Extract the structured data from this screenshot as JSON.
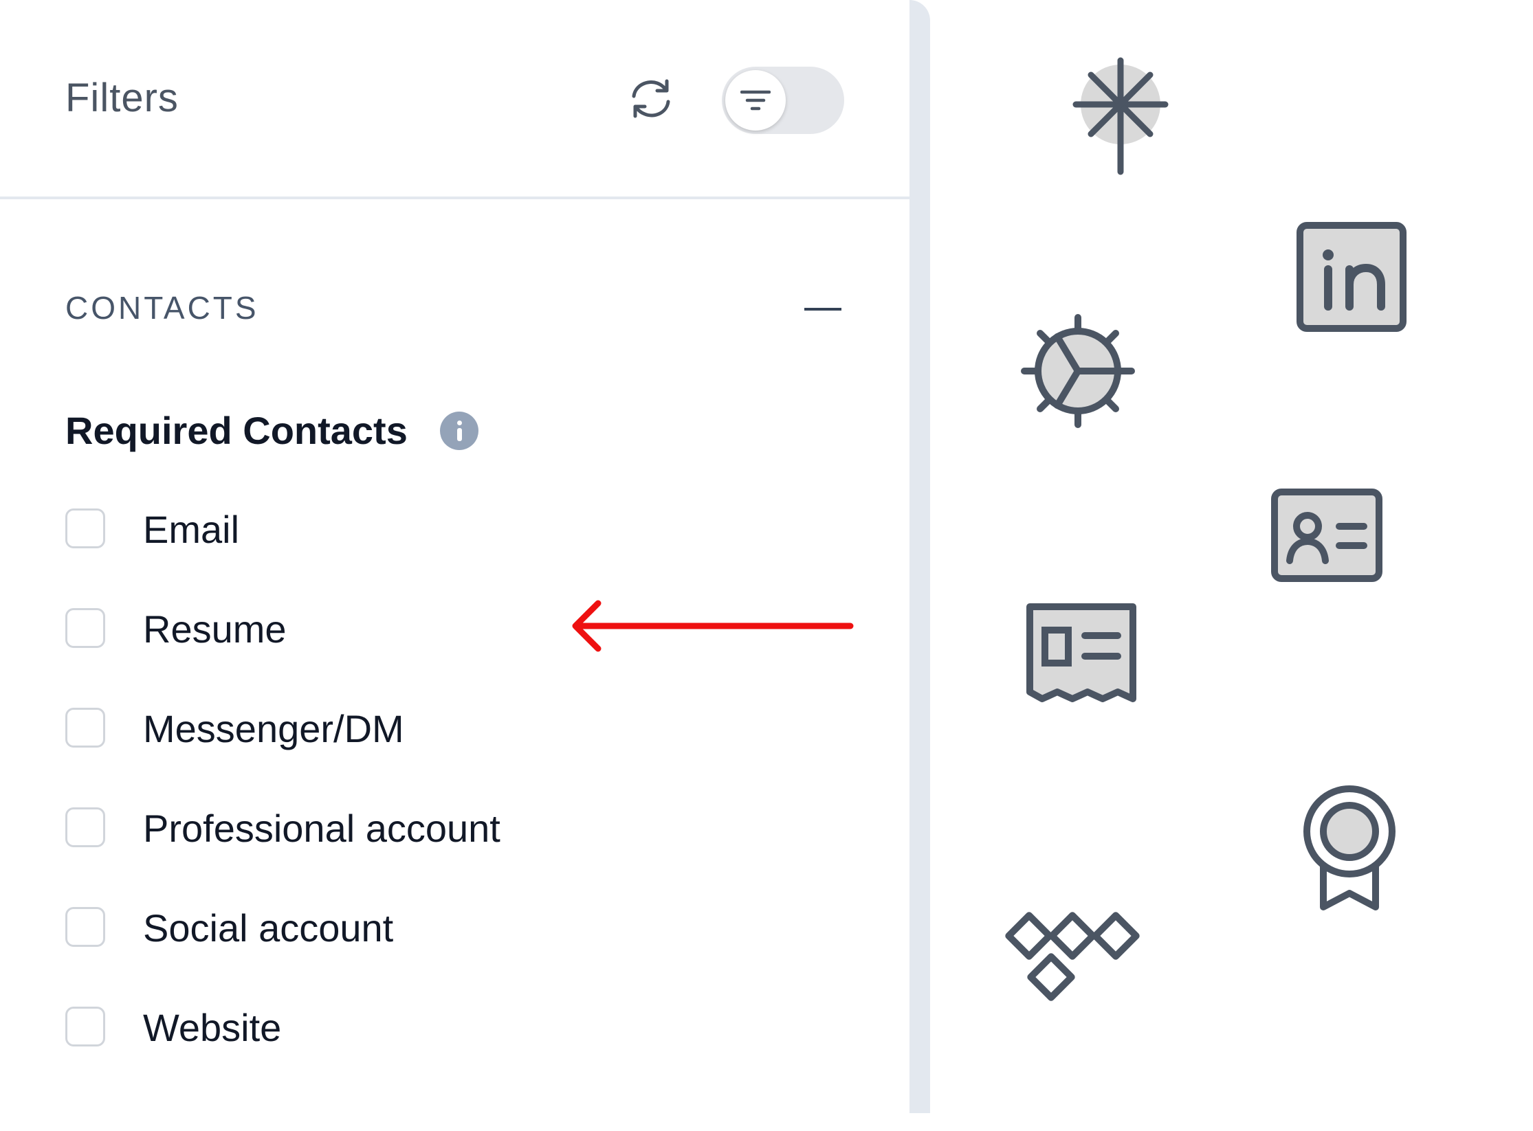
{
  "filters_panel": {
    "title": "Filters",
    "reset_icon": "refresh-icon",
    "filter_toggle_icon": "filter-lines-icon",
    "section": {
      "title": "CONTACTS",
      "collapse_icon": "minus-icon",
      "group": {
        "title": "Required Contacts",
        "info_icon": "info-icon",
        "options": [
          {
            "label": "Email",
            "checked": false
          },
          {
            "label": "Resume",
            "checked": false
          },
          {
            "label": "Messenger/DM",
            "checked": false
          },
          {
            "label": "Professional account",
            "checked": false
          },
          {
            "label": "Social account",
            "checked": false
          },
          {
            "label": "Website",
            "checked": false
          }
        ]
      }
    }
  },
  "annotation": {
    "arrow_color": "#ee1111",
    "points_to": "Resume"
  },
  "icon_palette": [
    "sparkle-icon",
    "linkedin-icon",
    "dribbble-sun-icon",
    "contact-card-icon",
    "resume-document-icon",
    "award-ribbon-icon",
    "diamond-pattern-icon"
  ],
  "colors": {
    "icon_stroke": "#4b5563",
    "icon_fill": "#d9d9d9",
    "divider": "#e3e8ef",
    "muted_text": "#4b5563",
    "info_badge": "#94a3b8"
  }
}
